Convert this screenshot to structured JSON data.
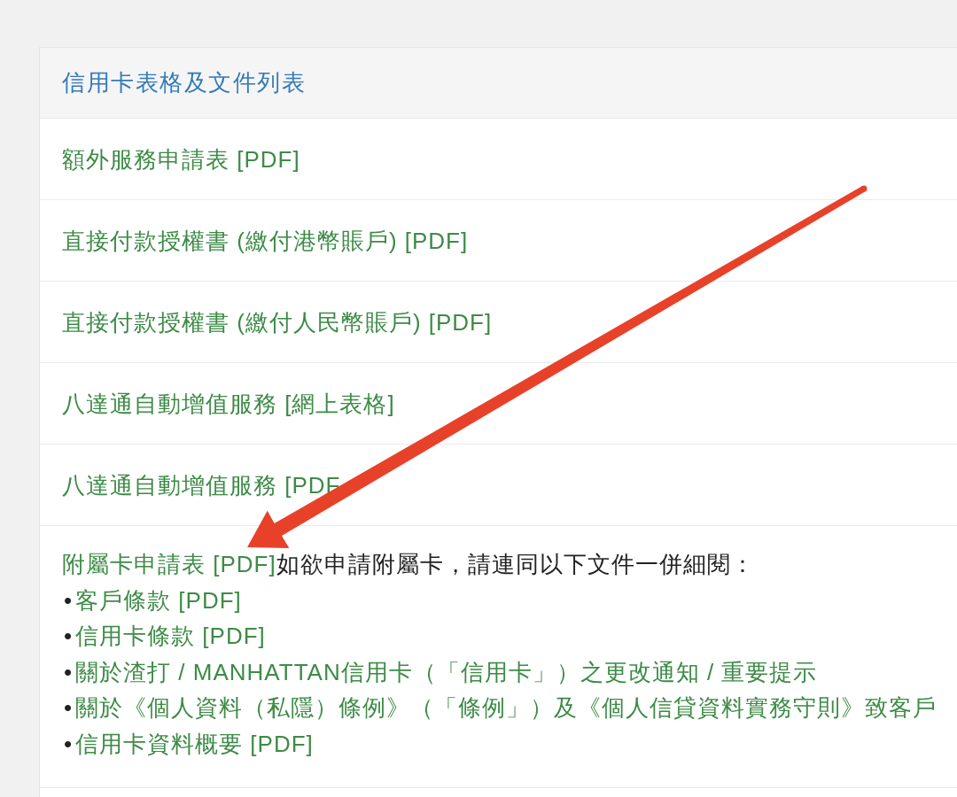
{
  "panel": {
    "title": "信用卡表格及文件列表",
    "rows": [
      {
        "kind": "link",
        "text": "額外服務申請表 [PDF]"
      },
      {
        "kind": "link",
        "text": "直接付款授權書 (繳付港幣賬戶) [PDF]"
      },
      {
        "kind": "link",
        "text": "直接付款授權書 (繳付人民幣賬戶) [PDF]"
      },
      {
        "kind": "link",
        "text": "八達通自動增值服務 [網上表格]"
      },
      {
        "kind": "link",
        "text": "八達通自動增值服務 [PDF"
      },
      {
        "kind": "note",
        "link": "附屬卡申請表 [PDF]",
        "text": "如欲申請附屬卡，請連同以下文件一併細閱：",
        "items": [
          {
            "bullet": "•",
            "text": "客戶條款 [PDF]"
          },
          {
            "bullet": "•",
            "text": "信用卡條款 [PDF]"
          },
          {
            "bullet": "•",
            "text": "關於渣打 / MANHATTAN信用卡（「信用卡」）之更改通知 / 重要提示"
          },
          {
            "bullet": "•",
            "text": "關於《個人資料（私隱）條例》（「條例」）及《個人信貸資料實務守則》致客戶"
          },
          {
            "bullet": "•",
            "text": "信用卡資料概要 [PDF]"
          }
        ]
      }
    ]
  }
}
